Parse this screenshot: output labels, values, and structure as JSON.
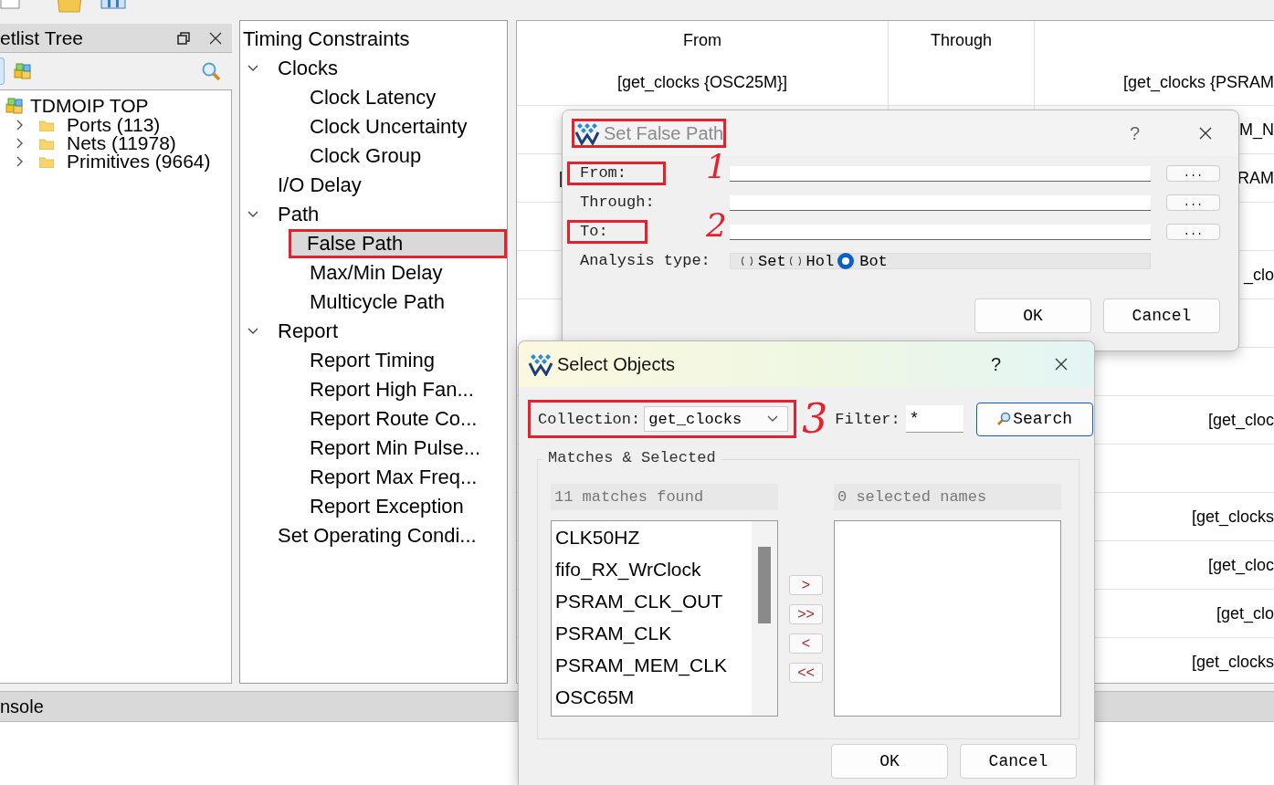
{
  "netlist_panel": {
    "title": "etlist Tree",
    "tree": [
      {
        "label": "TDMOIP TOP",
        "kind": "design",
        "children": [
          {
            "label": "Ports (113)",
            "kind": "folder",
            "expanded": false
          },
          {
            "label": "Nets (11978)",
            "kind": "folder",
            "expanded": false
          },
          {
            "label": "Primitives (9664)",
            "kind": "folder",
            "expanded": false
          }
        ]
      }
    ]
  },
  "constraints_tree": {
    "label": "Timing Constraints",
    "children": [
      {
        "label": "Clocks",
        "expanded": true,
        "selected": false,
        "children": [
          {
            "label": "Clock Latency",
            "selected": false
          },
          {
            "label": "Clock Uncertainty",
            "selected": false
          },
          {
            "label": "Clock Group",
            "selected": false
          }
        ]
      },
      {
        "label": "I/O Delay",
        "selected": false
      },
      {
        "label": "Path",
        "expanded": true,
        "selected": false,
        "children": [
          {
            "label": "False Path",
            "selected": true,
            "annotated": true
          },
          {
            "label": "Max/Min Delay",
            "selected": false
          },
          {
            "label": "Multicycle Path",
            "selected": false
          }
        ]
      },
      {
        "label": "Report",
        "expanded": true,
        "selected": false,
        "children": [
          {
            "label": "Report Timing",
            "selected": false
          },
          {
            "label": "Report High Fan...",
            "selected": false
          },
          {
            "label": "Report Route Co...",
            "selected": false
          },
          {
            "label": "Report Min Pulse...",
            "selected": false
          },
          {
            "label": "Report Max Freq...",
            "selected": false
          },
          {
            "label": "Report Exception",
            "selected": false
          }
        ]
      },
      {
        "label": "Set Operating Condi...",
        "selected": false
      }
    ]
  },
  "table": {
    "columns": [
      "From",
      "Through"
    ],
    "rows": [
      {
        "from": "[get_clocks {OSC25M}]",
        "column_3": "[get_clocks {PSRAM"
      },
      {
        "column_3": "M_N"
      },
      {
        "from": "[",
        "column_3": "RAM"
      },
      {},
      {
        "column_3": "_clo"
      },
      {},
      {},
      {
        "column_3": "[get_cloc"
      },
      {},
      {
        "column_3": "[get_clocks"
      },
      {
        "column_3": "[get_cloc"
      },
      {
        "column_3": "[get_clo"
      },
      {
        "column_3": "[get_clocks"
      }
    ]
  },
  "set_false_path_dialog": {
    "title": "Set False Path",
    "active": false,
    "title_annotated": true,
    "help": "?",
    "fields": [
      {
        "label": "From:",
        "annotated": true,
        "note": "1",
        "button": "..."
      },
      {
        "label": "Through:",
        "annotated": false,
        "button": "..."
      },
      {
        "label": "To:",
        "annotated": true,
        "note": "2",
        "button": "..."
      }
    ],
    "analysis": {
      "label": "Analysis type:",
      "options": [
        {
          "label": "Set",
          "selected": false
        },
        {
          "label": "Hol",
          "selected": false
        },
        {
          "label": "Bot",
          "selected": true
        }
      ]
    },
    "buttons": [
      "OK",
      "Cancel"
    ]
  },
  "select_objects_dialog": {
    "title": "Select Objects",
    "active": true,
    "help": "?",
    "collection": {
      "label": "Collection:",
      "value": "get_clocks",
      "annotated": true,
      "note": "3"
    },
    "filter": {
      "label": "Filter:",
      "value": "*"
    },
    "search_button": "Search",
    "group_title": "Matches & Selected",
    "matches_label": "11 matches found",
    "selected_label": "0 selected names",
    "matches": [
      "CLK50HZ",
      "fifo_RX_WrClock",
      "PSRAM_CLK_OUT",
      "PSRAM_CLK",
      "PSRAM_MEM_CLK",
      "OSC65M"
    ],
    "move_buttons": [
      ">",
      ">>",
      "<",
      "<<"
    ],
    "buttons": [
      "OK",
      "Cancel"
    ]
  },
  "console": {
    "title": "nsole"
  }
}
